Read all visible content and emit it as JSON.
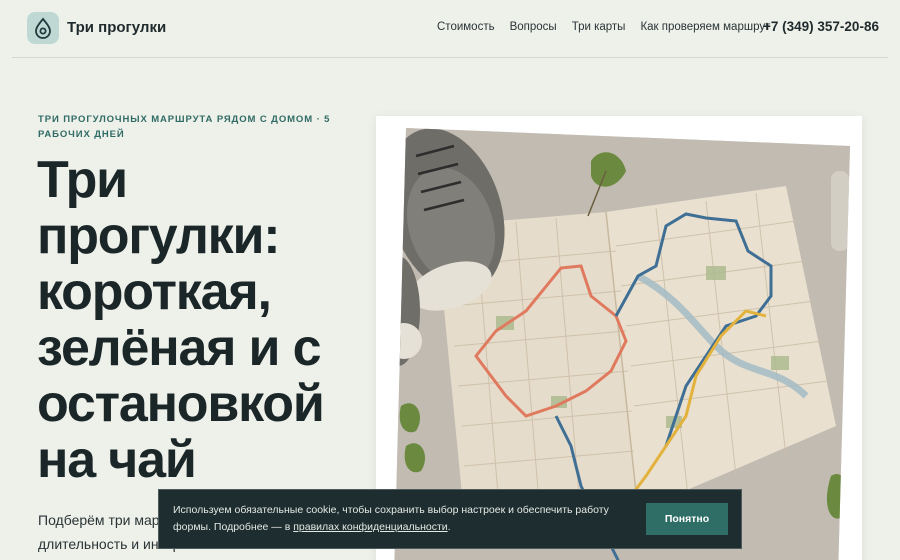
{
  "header": {
    "logo_icon": "map-pin-drop-icon",
    "brand": "Три прогулки",
    "nav": [
      "Стоимость",
      "Вопросы",
      "Три карты",
      "Как проверяем маршрут"
    ],
    "phone": "+7 (349) 357-20-86"
  },
  "hero": {
    "kicker": "ТРИ ПРОГУЛОЧНЫХ МАРШРУТА РЯДОМ С ДОМОМ · 5 РАБОЧИХ ДНЕЙ",
    "title": "Три прогулки: короткая, зелёная и с остановкой на чай",
    "subtitle": "Подберём три маршрута под ваш район, длительность и интересы"
  },
  "cookie": {
    "text_before": "Используем обязательные cookie, чтобы сохранить выбор настроек и обеспечить работу формы. Подробнее — в ",
    "link": "правилах конфиденциальности",
    "text_after": ".",
    "accept": "Понятно"
  },
  "colors": {
    "background": "#eef0ea",
    "accent": "#2e6e66",
    "banner": "#1e2d2f",
    "route_red": "#e07a5f",
    "route_blue": "#3f6f95",
    "route_yellow": "#e3b23c"
  }
}
